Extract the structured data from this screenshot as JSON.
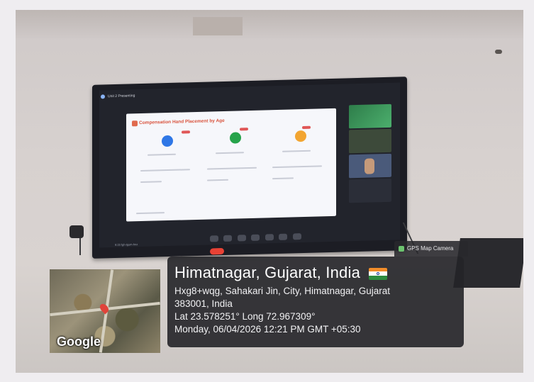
{
  "screen": {
    "meeting_title": "Unit 2 Presenting",
    "slide_title": "Compensation Hand Placement by Age",
    "tv_caption": "9:23 fgh-tgsm-hnz"
  },
  "map": {
    "logo_text": "Google"
  },
  "gps_tag": {
    "label": "GPS Map Camera"
  },
  "location": {
    "title": "Himatnagar, Gujarat, India",
    "address_line1": "Hxg8+wqg, Sahakari Jin, City, Himatnagar, Gujarat",
    "address_line2": "383001, India",
    "coordinates": "Lat 23.578251° Long 72.967309°",
    "datetime": "Monday, 06/04/2026 12:21 PM GMT +05:30"
  },
  "colors": {
    "info_bg": "#242428",
    "end_call": "#e94235",
    "slide_accent": "#d9543e"
  }
}
